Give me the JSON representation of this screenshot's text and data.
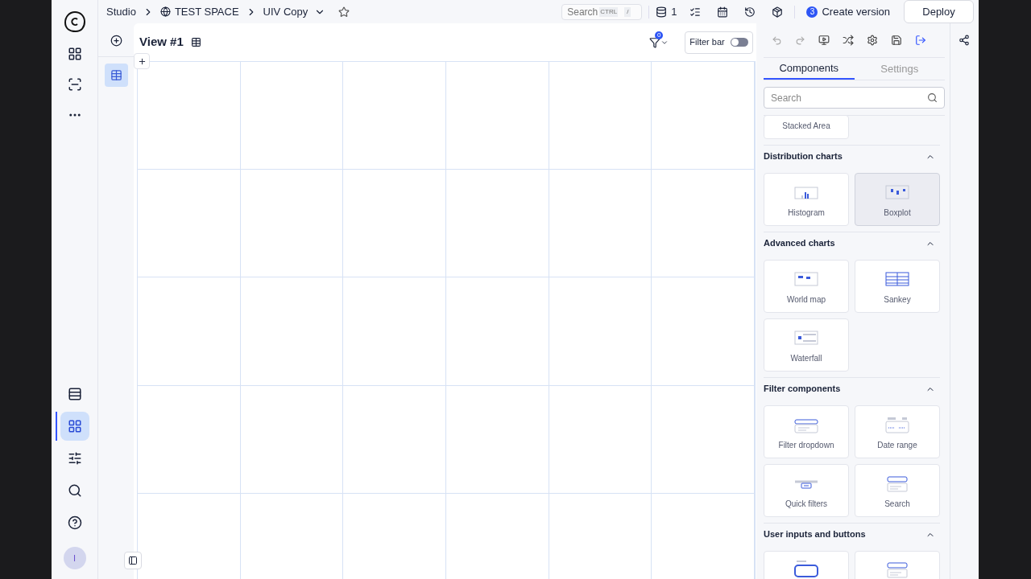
{
  "breadcrumb": [
    {
      "label": "Studio",
      "kind": "text"
    },
    {
      "label": "TEST SPACE",
      "kind": "space"
    },
    {
      "label": "UIV Copy",
      "kind": "dropdown"
    }
  ],
  "top_bar": {
    "search": {
      "placeholder": "Search",
      "shortcut": [
        "CTRL",
        "/"
      ]
    },
    "db_count": "1",
    "version_count": "3",
    "create_version": "Create version",
    "deploy": "Deploy"
  },
  "view": {
    "title": "View #1",
    "filter_count": "0",
    "filter_bar": {
      "label": "Filter bar",
      "on": false
    }
  },
  "left_nav": [
    {
      "kind": "pages",
      "selected": false
    },
    {
      "kind": "components",
      "selected": true
    },
    {
      "kind": "settings",
      "selected": false
    },
    {
      "kind": "search",
      "selected": false
    },
    {
      "kind": "help",
      "selected": false
    }
  ],
  "avatar": "I",
  "panel": {
    "tabs": [
      {
        "label": "Components",
        "selected": true
      },
      {
        "label": "Settings",
        "selected": false
      }
    ],
    "search": {
      "placeholder": "Search"
    },
    "sections": [
      {
        "cards": [
          {
            "label": "Stacked Area",
            "kind": "none",
            "selected": false
          }
        ]
      },
      {
        "title": "Distribution charts",
        "expanded": true,
        "cards": [
          {
            "label": "Histogram",
            "kind": "histogram",
            "selected": false
          },
          {
            "label": "Boxplot",
            "kind": "boxplot",
            "selected": true
          }
        ]
      },
      {
        "title": "Advanced charts",
        "expanded": true,
        "cards": [
          {
            "label": "World map",
            "kind": "map",
            "selected": false
          },
          {
            "label": "Sankey",
            "kind": "sankey",
            "selected": false
          },
          {
            "label": "Waterfall",
            "kind": "waterfall",
            "selected": false
          }
        ]
      },
      {
        "title": "Filter components",
        "expanded": true,
        "cards": [
          {
            "label": "Filter dropdown",
            "kind": "dropdown",
            "selected": false
          },
          {
            "label": "Date range",
            "kind": "calendar",
            "selected": false
          },
          {
            "label": "Quick filters",
            "kind": "quick",
            "selected": false
          },
          {
            "label": "Search",
            "kind": "searchbox",
            "selected": false
          }
        ]
      },
      {
        "title": "User inputs and buttons",
        "expanded": true,
        "cards": [
          {
            "kind": "input",
            "selected": false
          },
          {
            "kind": "searchbox",
            "selected": false
          }
        ]
      }
    ]
  }
}
